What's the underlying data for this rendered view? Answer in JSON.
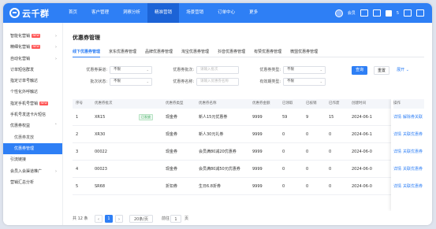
{
  "brand": {
    "logo_text": "云千群"
  },
  "topnav": {
    "items": [
      {
        "label": "首页"
      },
      {
        "label": "客户管理"
      },
      {
        "label": "洞察分析"
      },
      {
        "label": "精准营销"
      },
      {
        "label": "场景营销"
      },
      {
        "label": "订单中心"
      },
      {
        "label": "更多"
      }
    ],
    "active_index": 3,
    "user_name": "会员",
    "num_badge": "5"
  },
  "sidebar": {
    "items": [
      {
        "label": "智能化营销",
        "hot": "NEW",
        "chevron": "›"
      },
      {
        "label": "精细化营销",
        "hot": "NEW",
        "chevron": "›"
      },
      {
        "label": "自动化营销",
        "hot": "",
        "chevron": "›"
      },
      {
        "label": "订单短信群发",
        "hot": "",
        "chevron": ""
      },
      {
        "label": "指定订单号触达",
        "hot": "",
        "chevron": ""
      },
      {
        "label": "个性化外呼触达",
        "hot": "",
        "chevron": ""
      },
      {
        "label": "指定手机号营销",
        "hot": "NEW",
        "chevron": ""
      },
      {
        "label": "手机号发送卡片短信",
        "hot": "",
        "chevron": ""
      },
      {
        "label": "优惠券权益",
        "hot": "",
        "chevron": "˄"
      },
      {
        "label": "优惠券发放",
        "hot": "",
        "chevron": "",
        "sub": true
      },
      {
        "label": "优惠券管理",
        "hot": "",
        "chevron": "",
        "sub": true,
        "active": true
      },
      {
        "label": "引流链接",
        "hot": "",
        "chevron": ""
      },
      {
        "label": "会员入会渠道推广",
        "hot": "",
        "chevron": "›"
      },
      {
        "label": "营销汇总分析",
        "hot": "",
        "chevron": ""
      }
    ]
  },
  "page": {
    "title": "优惠券管理",
    "tabs": [
      "线下优惠券管理",
      "京东优惠券管理",
      "品牌优惠券管理",
      "淘宝优惠券管理",
      "抖音优惠券管理",
      "有赞优惠券管理",
      "微盟优惠券管理"
    ],
    "active_tab": 0
  },
  "filters": {
    "row1": [
      {
        "label": "优惠券渠道:",
        "value": "不限",
        "placeholder": "",
        "dropdown": true
      },
      {
        "label": "优惠券批次:",
        "value": "",
        "placeholder": "请输入批次",
        "dropdown": false
      },
      {
        "label": "优惠券类型:",
        "value": "不限",
        "placeholder": "",
        "dropdown": true
      }
    ],
    "row2": [
      {
        "label": "批次状态:",
        "value": "不限",
        "placeholder": "",
        "dropdown": true
      },
      {
        "label": "优惠券名称:",
        "value": "",
        "placeholder": "请输入优惠券名称",
        "dropdown": false
      },
      {
        "label": "有效期类型:",
        "value": "不限",
        "placeholder": "",
        "dropdown": true
      }
    ],
    "search_label": "查询",
    "reset_label": "重置",
    "expand_label": "展开 ⌄"
  },
  "table": {
    "headers": [
      "序号",
      "优惠券批次",
      "",
      "优惠券类型",
      "优惠券名称",
      "优惠券金额",
      "已领取",
      "已核销",
      "已作废",
      "创建时间",
      "操作"
    ],
    "rows": [
      {
        "idx": "1",
        "batch": "XR15",
        "tag": "已发放",
        "type": "现金券",
        "name": "新人15元优惠券",
        "amount": "9999",
        "received": "59",
        "used": "9",
        "void": "15",
        "created": "2024-06-1",
        "ops": [
          "详情",
          "解除券关联"
        ]
      },
      {
        "idx": "2",
        "batch": "XR30",
        "tag": "",
        "type": "现金券",
        "name": "新人30元礼券",
        "amount": "9999",
        "received": "0",
        "used": "0",
        "void": "0",
        "created": "2024-06-1",
        "ops": [
          "详情",
          "关联优惠券"
        ]
      },
      {
        "idx": "3",
        "batch": "00022",
        "tag": "",
        "type": "现金券",
        "name": "会员满80减20优惠券",
        "amount": "9999",
        "received": "0",
        "used": "0",
        "void": "0",
        "created": "2024-06-0",
        "ops": [
          "详情",
          "关联优惠券"
        ]
      },
      {
        "idx": "4",
        "batch": "00023",
        "tag": "",
        "type": "现金券",
        "name": "会员满80减50元优惠券",
        "amount": "9999",
        "received": "0",
        "used": "0",
        "void": "0",
        "created": "2024-06-0",
        "ops": [
          "详情",
          "关联优惠券"
        ]
      },
      {
        "idx": "5",
        "batch": "SR68",
        "tag": "",
        "type": "折扣券",
        "name": "生日6.8折券",
        "amount": "9999",
        "received": "0",
        "used": "0",
        "void": "0",
        "created": "2024-06-0",
        "ops": [
          "详情",
          "关联优惠券"
        ]
      }
    ]
  },
  "pager": {
    "total": "共 12 条",
    "prev": "‹",
    "page": "1",
    "next": "›",
    "size": "20条/页",
    "goto_label": "前往",
    "goto_value": "1",
    "goto_unit": "页"
  },
  "colors": {
    "primary": "#2e7ff5",
    "topbar": "#2e7ff5",
    "hot_badge": "#ff5555"
  }
}
